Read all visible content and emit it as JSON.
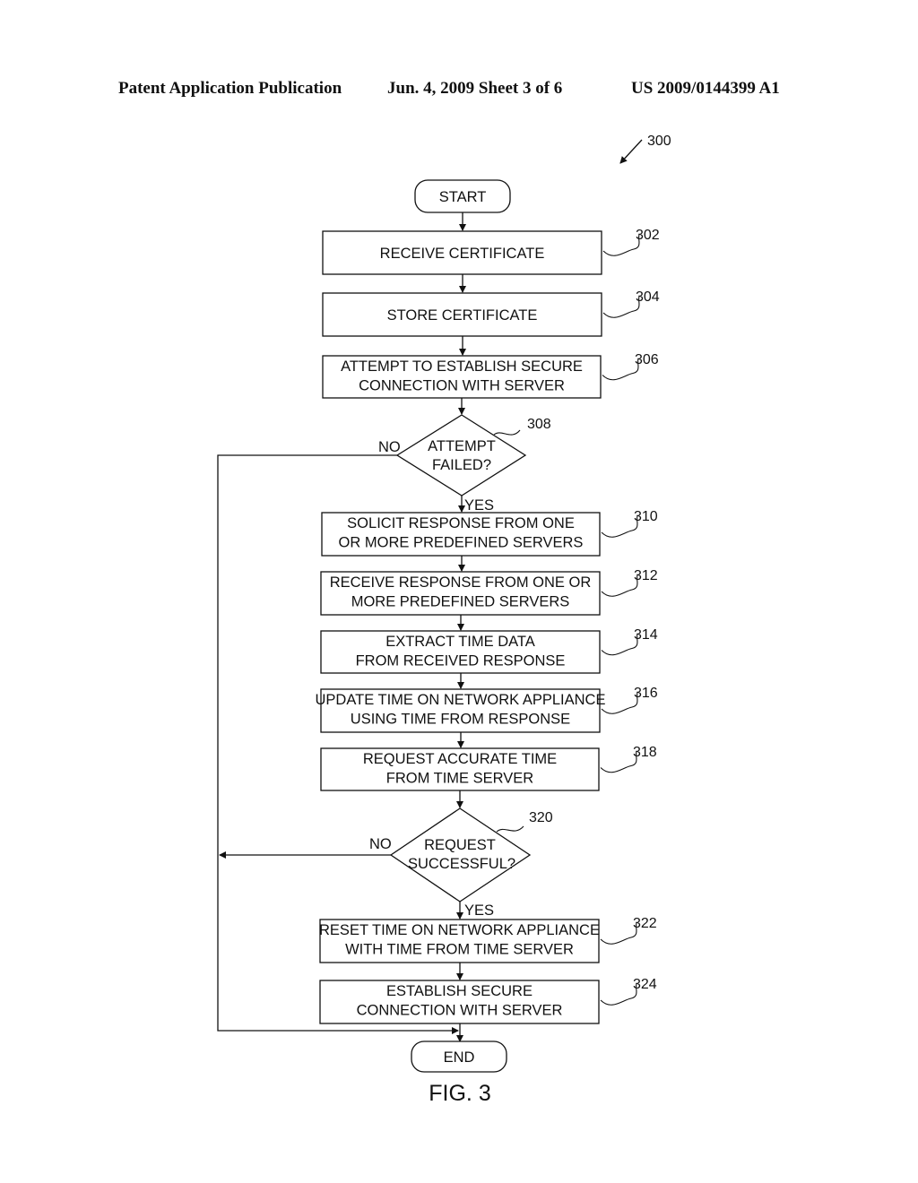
{
  "header": {
    "publication": "Patent Application Publication",
    "date_sheet": "Jun. 4, 2009   Sheet 3 of 6",
    "patent_number": "US 2009/0144399 A1"
  },
  "figure": {
    "ref": "300",
    "caption": "FIG. 3"
  },
  "terminals": {
    "start": "START",
    "end": "END"
  },
  "steps": [
    {
      "id": "302",
      "lines": [
        "RECEIVE CERTIFICATE"
      ]
    },
    {
      "id": "304",
      "lines": [
        "STORE CERTIFICATE"
      ]
    },
    {
      "id": "306",
      "lines": [
        "ATTEMPT TO ESTABLISH SECURE",
        "CONNECTION WITH SERVER"
      ]
    },
    {
      "id": "310",
      "lines": [
        "SOLICIT RESPONSE FROM ONE",
        "OR MORE PREDEFINED SERVERS"
      ]
    },
    {
      "id": "312",
      "lines": [
        "RECEIVE RESPONSE FROM ONE OR",
        "MORE PREDEFINED SERVERS"
      ]
    },
    {
      "id": "314",
      "lines": [
        "EXTRACT TIME DATA",
        "FROM RECEIVED RESPONSE"
      ]
    },
    {
      "id": "316",
      "lines": [
        "UPDATE TIME ON NETWORK APPLIANCE",
        "USING TIME FROM RESPONSE"
      ]
    },
    {
      "id": "318",
      "lines": [
        "REQUEST ACCURATE TIME",
        "FROM TIME SERVER"
      ]
    },
    {
      "id": "322",
      "lines": [
        "RESET TIME ON NETWORK APPLIANCE",
        "WITH TIME FROM TIME SERVER"
      ]
    },
    {
      "id": "324",
      "lines": [
        "ESTABLISH SECURE",
        "CONNECTION WITH SERVER"
      ]
    }
  ],
  "decisions": [
    {
      "id": "308",
      "lines": [
        "ATTEMPT",
        "FAILED?"
      ],
      "yes": "YES",
      "no": "NO"
    },
    {
      "id": "320",
      "lines": [
        "REQUEST",
        "SUCCESSFUL?"
      ],
      "yes": "YES",
      "no": "NO"
    }
  ]
}
